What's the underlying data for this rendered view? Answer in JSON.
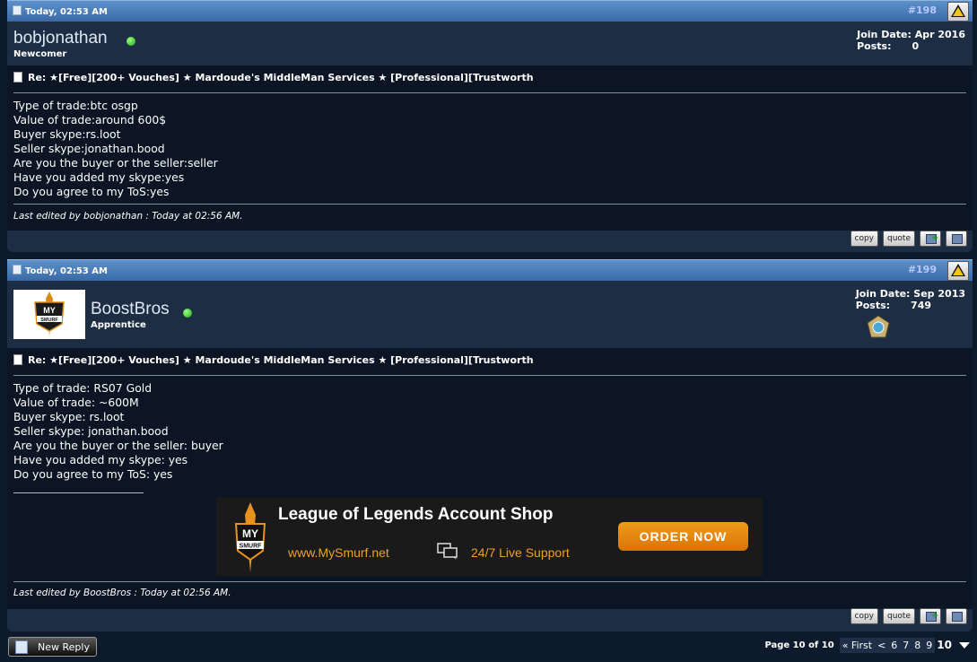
{
  "posts": [
    {
      "date": "Today, 02:53 AM",
      "number": "#198",
      "username": "bobjonathan",
      "user_title": "Newcomer",
      "join_date_label": "Join Date:",
      "join_date": "Apr 2016",
      "posts_label": "Posts:",
      "posts_count": "0",
      "title": "Re: ★[Free][200+ Vouches] ★ Mardoude's MiddleMan Services ★ [Professional][Trustworth",
      "lines": [
        "Type of trade:btc osgp",
        "Value of trade:around 600$",
        "Buyer skype:rs.loot",
        "Seller skype:jonathan.bood",
        "Are you the buyer or the seller:seller",
        "Have you added my skype:yes",
        "Do you agree to my ToS:yes"
      ],
      "edited": "Last edited by bobjonathan : Today at 02:56 AM.",
      "copy_label": "copy",
      "quote_label": "quote"
    },
    {
      "date": "Today, 02:53 AM",
      "number": "#199",
      "username": "BoostBros",
      "user_title": "Apprentice",
      "join_date_label": "Join Date:",
      "join_date": "Sep 2013",
      "posts_label": "Posts:",
      "posts_count": "749",
      "avatar_text": [
        "MY",
        "SMURF"
      ],
      "title": "Re: ★[Free][200+ Vouches] ★ Mardoude's MiddleMan Services ★ [Professional][Trustworth",
      "lines": [
        "Type of trade: RS07 Gold",
        "Value of trade: ~600M",
        "Buyer skype: rs.loot",
        "Seller skype: jonathan.bood",
        "Are you the buyer or the seller: buyer",
        "Have you added my skype: yes",
        "Do you agree to my ToS: yes"
      ],
      "banner": {
        "headline": "League of Legends Account Shop",
        "url": "www.MySmurf.net",
        "support": "24/7 Live Support",
        "cta": "ORDER NOW",
        "logo_top": "MY",
        "logo_bottom": "SMURF"
      },
      "edited": "Last edited by BoostBros : Today at 02:56 AM.",
      "copy_label": "copy",
      "quote_label": "quote"
    }
  ],
  "footer": {
    "new_reply": "New Reply",
    "page_info": "Page 10 of 10",
    "first": "« First",
    "prev": "<",
    "pages": [
      "6",
      "7",
      "8",
      "9"
    ],
    "current": "10"
  },
  "colors": {
    "header_gradient_top": "#5d91c9",
    "header_gradient_bottom": "#3a6aa6",
    "post_bg": "#1c2d44",
    "body_bg": "#0b1524",
    "online": "#1fa31f",
    "post_number": "#b7c8ff",
    "banner_orange": "#f19a1c"
  }
}
